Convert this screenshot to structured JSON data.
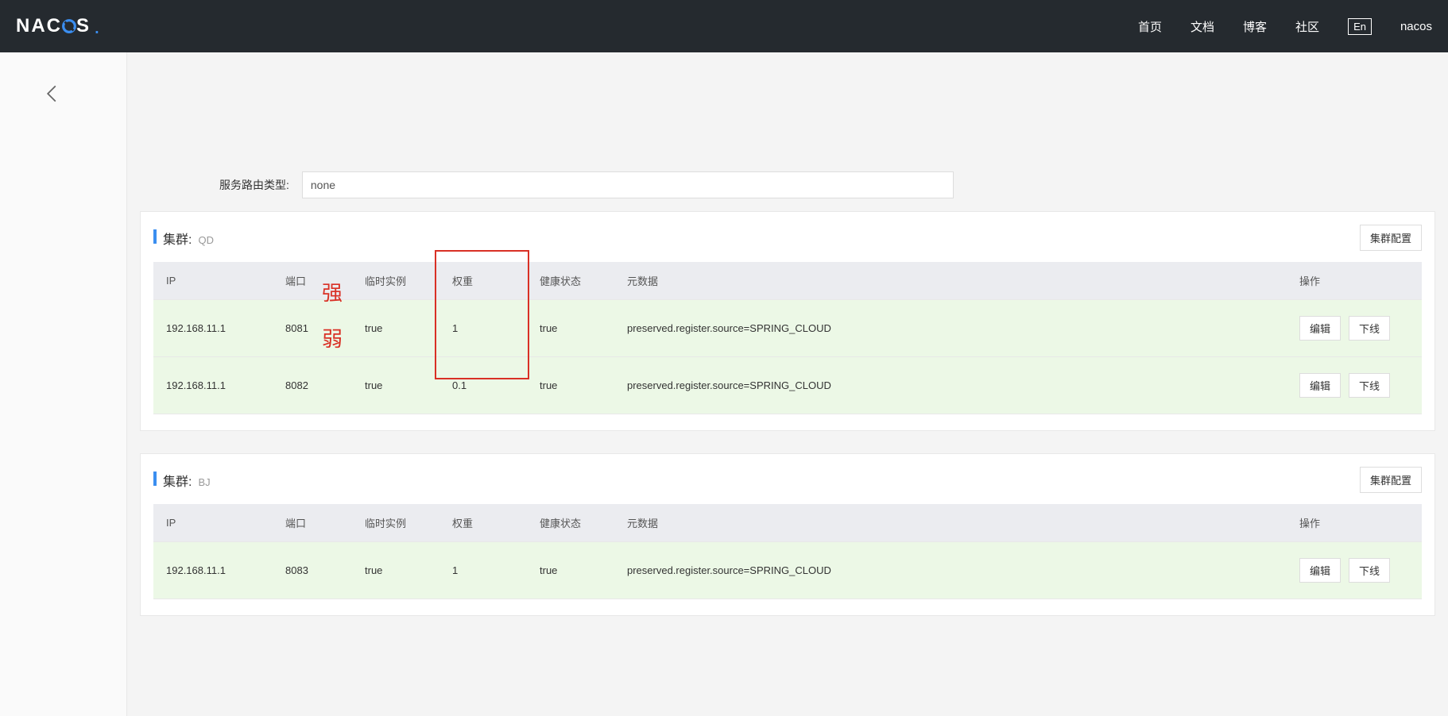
{
  "header": {
    "logo_text": "NACOS",
    "nav": {
      "home": "首页",
      "docs": "文档",
      "blog": "博客",
      "community": "社区",
      "lang": "En",
      "user": "nacos"
    }
  },
  "route": {
    "label": "服务路由类型:",
    "value": "none"
  },
  "buttons": {
    "cluster_config": "集群配置",
    "edit": "编辑",
    "offline": "下线"
  },
  "table_columns": {
    "ip": "IP",
    "port": "端口",
    "ephemeral": "临时实例",
    "weight": "权重",
    "health": "健康状态",
    "metadata": "元数据",
    "ops": "操作"
  },
  "clusters": [
    {
      "label": "集群:",
      "name": "QD",
      "instances": [
        {
          "ip": "192.168.11.1",
          "port": "8081",
          "ephemeral": "true",
          "weight": "1",
          "health": "true",
          "metadata": "preserved.register.source=SPRING_CLOUD"
        },
        {
          "ip": "192.168.11.1",
          "port": "8082",
          "ephemeral": "true",
          "weight": "0.1",
          "health": "true",
          "metadata": "preserved.register.source=SPRING_CLOUD"
        }
      ]
    },
    {
      "label": "集群:",
      "name": "BJ",
      "instances": [
        {
          "ip": "192.168.11.1",
          "port": "8083",
          "ephemeral": "true",
          "weight": "1",
          "health": "true",
          "metadata": "preserved.register.source=SPRING_CLOUD"
        }
      ]
    }
  ],
  "annotations": {
    "strong": "强",
    "weak": "弱"
  }
}
